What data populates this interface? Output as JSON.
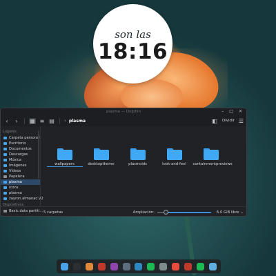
{
  "clock": {
    "label": "son las",
    "time": "18:16"
  },
  "window": {
    "title": "plasma — Dolphin",
    "breadcrumb": "plasma",
    "split_label": "Dividir",
    "controls": {
      "minimize": "–",
      "maximize": "□",
      "close": "✕"
    }
  },
  "sidebar": {
    "places_heading": "Lugares",
    "places": [
      {
        "label": "Carpeta personal",
        "icon": "home-folder-icon"
      },
      {
        "label": "Escritorio",
        "icon": "desktop-folder-icon"
      },
      {
        "label": "Documentos",
        "icon": "documents-folder-icon"
      },
      {
        "label": "Descargas",
        "icon": "downloads-folder-icon"
      },
      {
        "label": "Música",
        "icon": "music-folder-icon"
      },
      {
        "label": "Imágenes",
        "icon": "pictures-folder-icon"
      },
      {
        "label": "Vídeos",
        "icon": "videos-folder-icon"
      },
      {
        "label": "Papelera",
        "icon": "trash-icon"
      },
      {
        "label": "plasma",
        "icon": "folder-icon"
      },
      {
        "label": "icons",
        "icon": "folder-icon"
      },
      {
        "label": "plasma",
        "icon": "folder-icon"
      },
      {
        "label": "zayron.almanac.V2",
        "icon": "folder-icon"
      }
    ],
    "selected_index": 8,
    "devices_heading": "Dispositivos",
    "devices": [
      {
        "label": "Basic data partiti...",
        "icon": "drive-icon"
      }
    ]
  },
  "folders": [
    {
      "name": "wallpapers"
    },
    {
      "name": "desktoptheme"
    },
    {
      "name": "plasmoids"
    },
    {
      "name": "look-and-feel"
    },
    {
      "name": "containmentpreviews"
    }
  ],
  "status": {
    "count": "5 carpetas",
    "zoom_label": "Ampliación:",
    "zoom_fraction": 0.15,
    "free_space": "6.0 GiB libre"
  },
  "colors": {
    "folder_blue": "#3fa9f5",
    "selection": "#2d4a6b",
    "accent": "#3d8fd9"
  },
  "dock": [
    {
      "name": "finder-app-icon",
      "color": "#4aa3e8"
    },
    {
      "name": "terminal-app-icon",
      "color": "#2b2e32"
    },
    {
      "name": "archive-app-icon",
      "color": "#e0893a"
    },
    {
      "name": "presentation-app-icon",
      "color": "#c0392b"
    },
    {
      "name": "image-viewer-app-icon",
      "color": "#8e44ad"
    },
    {
      "name": "settings-app-icon",
      "color": "#5d6d7e"
    },
    {
      "name": "system-monitor-app-icon",
      "color": "#2e86c1"
    },
    {
      "name": "spotify-app-icon",
      "color": "#1db954"
    },
    {
      "name": "gimp-app-icon",
      "color": "#7f8c8d"
    },
    {
      "name": "torrent-app-icon",
      "color": "#e74c3c"
    },
    {
      "name": "chat-app-icon",
      "color": "#c0392b"
    },
    {
      "name": "spotify-app-icon-2",
      "color": "#1db954"
    },
    {
      "name": "editor-app-icon",
      "color": "#5dade2"
    }
  ]
}
